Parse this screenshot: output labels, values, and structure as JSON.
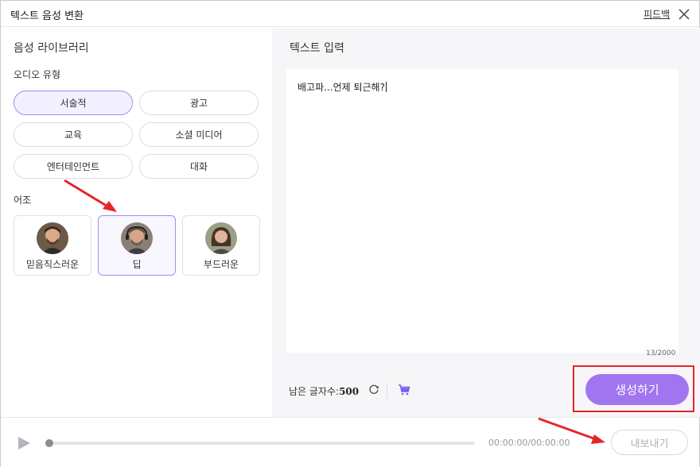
{
  "window": {
    "title": "텍스트 음성 변환",
    "feedback_label": "피드백"
  },
  "left": {
    "library_title": "음성 라이브러리",
    "audio_type_label": "오디오 유형",
    "audio_types": [
      "서술적",
      "광고",
      "교육",
      "소셜 미디어",
      "엔터테인먼트",
      "대화"
    ],
    "selected_audio_type": "서술적",
    "tone_label": "어조",
    "voices": [
      "믿음직스러운",
      "딥",
      "부드러운"
    ],
    "selected_voice": "딥"
  },
  "right": {
    "input_title": "텍스트 입력",
    "input_text": "배고파...언제 퇴근해?",
    "char_counter": "13/2000",
    "remaining_label": "남은 글자수:",
    "remaining_value": "500",
    "generate_label": "생성하기"
  },
  "player": {
    "time": "00:00:00/00:00:00",
    "export_label": "내보내기"
  },
  "colors": {
    "accent": "#a175f0",
    "highlight_box": "#e4262b",
    "arrow": "#e4262b"
  }
}
